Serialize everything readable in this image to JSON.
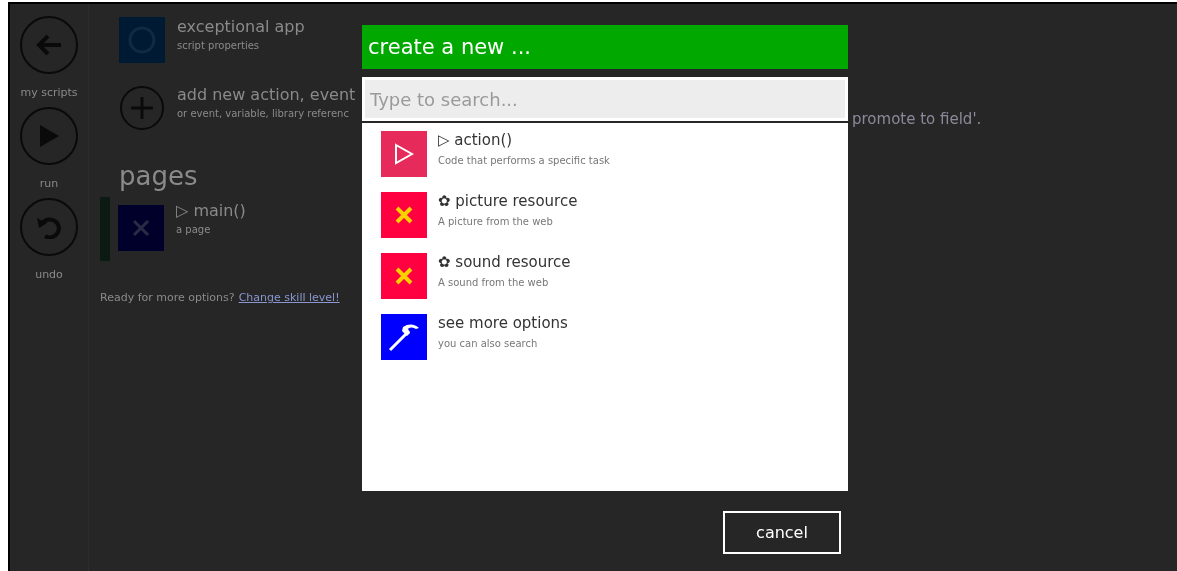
{
  "sidebar": {
    "buttons": [
      {
        "kind": "back",
        "label": "my scripts"
      },
      {
        "kind": "run",
        "label": "run"
      },
      {
        "kind": "undo",
        "label": "undo"
      }
    ]
  },
  "background": {
    "items": [
      {
        "kind": "app",
        "title": "exceptional app",
        "subtitle": "script properties"
      },
      {
        "kind": "add",
        "title": "add new action, event",
        "subtitle": "or event, variable, library referenc"
      }
    ],
    "pages_heading": "pages",
    "pages": [
      {
        "title": "▷ main()",
        "subtitle": "a page"
      }
    ],
    "hint": "Ready for more options?",
    "hint_link": "Change skill level!",
    "note": "promote to field'."
  },
  "dialog": {
    "title": "create a new ...",
    "search": {
      "placeholder": "Type to search..."
    },
    "items": [
      {
        "kind": "action",
        "title": "▷ action()",
        "subtitle": "Code that performs a specific task"
      },
      {
        "kind": "resource",
        "title": "✿ picture resource",
        "subtitle": "A picture from the web"
      },
      {
        "kind": "resource",
        "title": "✿ sound resource",
        "subtitle": "A sound from the web"
      },
      {
        "kind": "more",
        "title": "see more options",
        "subtitle": "you can also search"
      }
    ],
    "cancel": "cancel"
  }
}
